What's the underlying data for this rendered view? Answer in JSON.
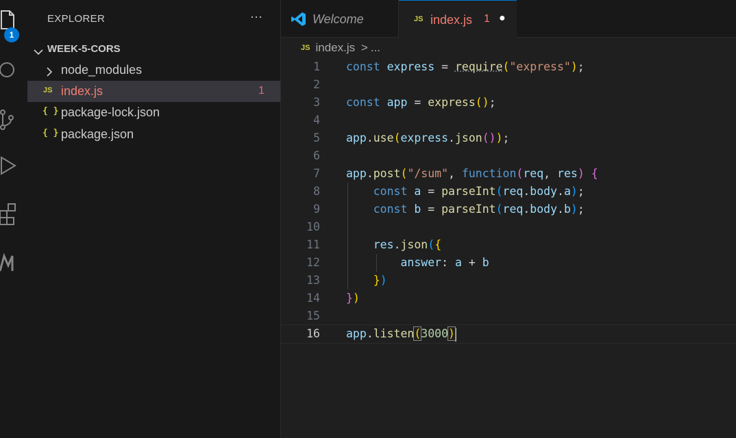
{
  "activity_bar": {
    "icons": [
      "files-icon",
      "search-icon",
      "source-control-icon",
      "run-debug-icon",
      "extensions-icon",
      "remote-icon"
    ],
    "explorer_badge": "1"
  },
  "sidebar": {
    "title": "EXPLORER",
    "more_label": "···",
    "folder": "WEEK-5-CORS",
    "items": [
      {
        "label": "node_modules",
        "type": "folder"
      },
      {
        "label": "index.js",
        "type": "js",
        "badge": "JS",
        "problems": "1"
      },
      {
        "label": "package-lock.json",
        "type": "json",
        "badge": "{ }"
      },
      {
        "label": "package.json",
        "type": "json",
        "badge": "{ }"
      }
    ]
  },
  "tabs": [
    {
      "label": "Welcome",
      "icon": "vscode-logo-icon"
    },
    {
      "label": "index.js",
      "badge": "JS",
      "problems": "1",
      "dirty": "●"
    }
  ],
  "breadcrumb": {
    "file_badge": "JS",
    "file": "index.js",
    "sep": ">",
    "rest": "..."
  },
  "editor": {
    "lines": [
      {
        "n": "1",
        "text": "const express = require(\"express\");"
      },
      {
        "n": "2",
        "text": ""
      },
      {
        "n": "3",
        "text": "const app = express();"
      },
      {
        "n": "4",
        "text": ""
      },
      {
        "n": "5",
        "text": "app.use(express.json());"
      },
      {
        "n": "6",
        "text": ""
      },
      {
        "n": "7",
        "text": "app.post(\"/sum\", function(req, res) {"
      },
      {
        "n": "8",
        "text": "    const a = parseInt(req.body.a);"
      },
      {
        "n": "9",
        "text": "    const b = parseInt(req.body.b);"
      },
      {
        "n": "10",
        "text": ""
      },
      {
        "n": "11",
        "text": "    res.json({"
      },
      {
        "n": "12",
        "text": "        answer: a + b"
      },
      {
        "n": "13",
        "text": "    })"
      },
      {
        "n": "14",
        "text": "})"
      },
      {
        "n": "15",
        "text": ""
      },
      {
        "n": "16",
        "text": "app.listen(3000)"
      }
    ],
    "current_line": "16"
  },
  "colors": {
    "accent": "#0078d4",
    "error": "#f27c72",
    "js_badge": "#cbcb41"
  }
}
